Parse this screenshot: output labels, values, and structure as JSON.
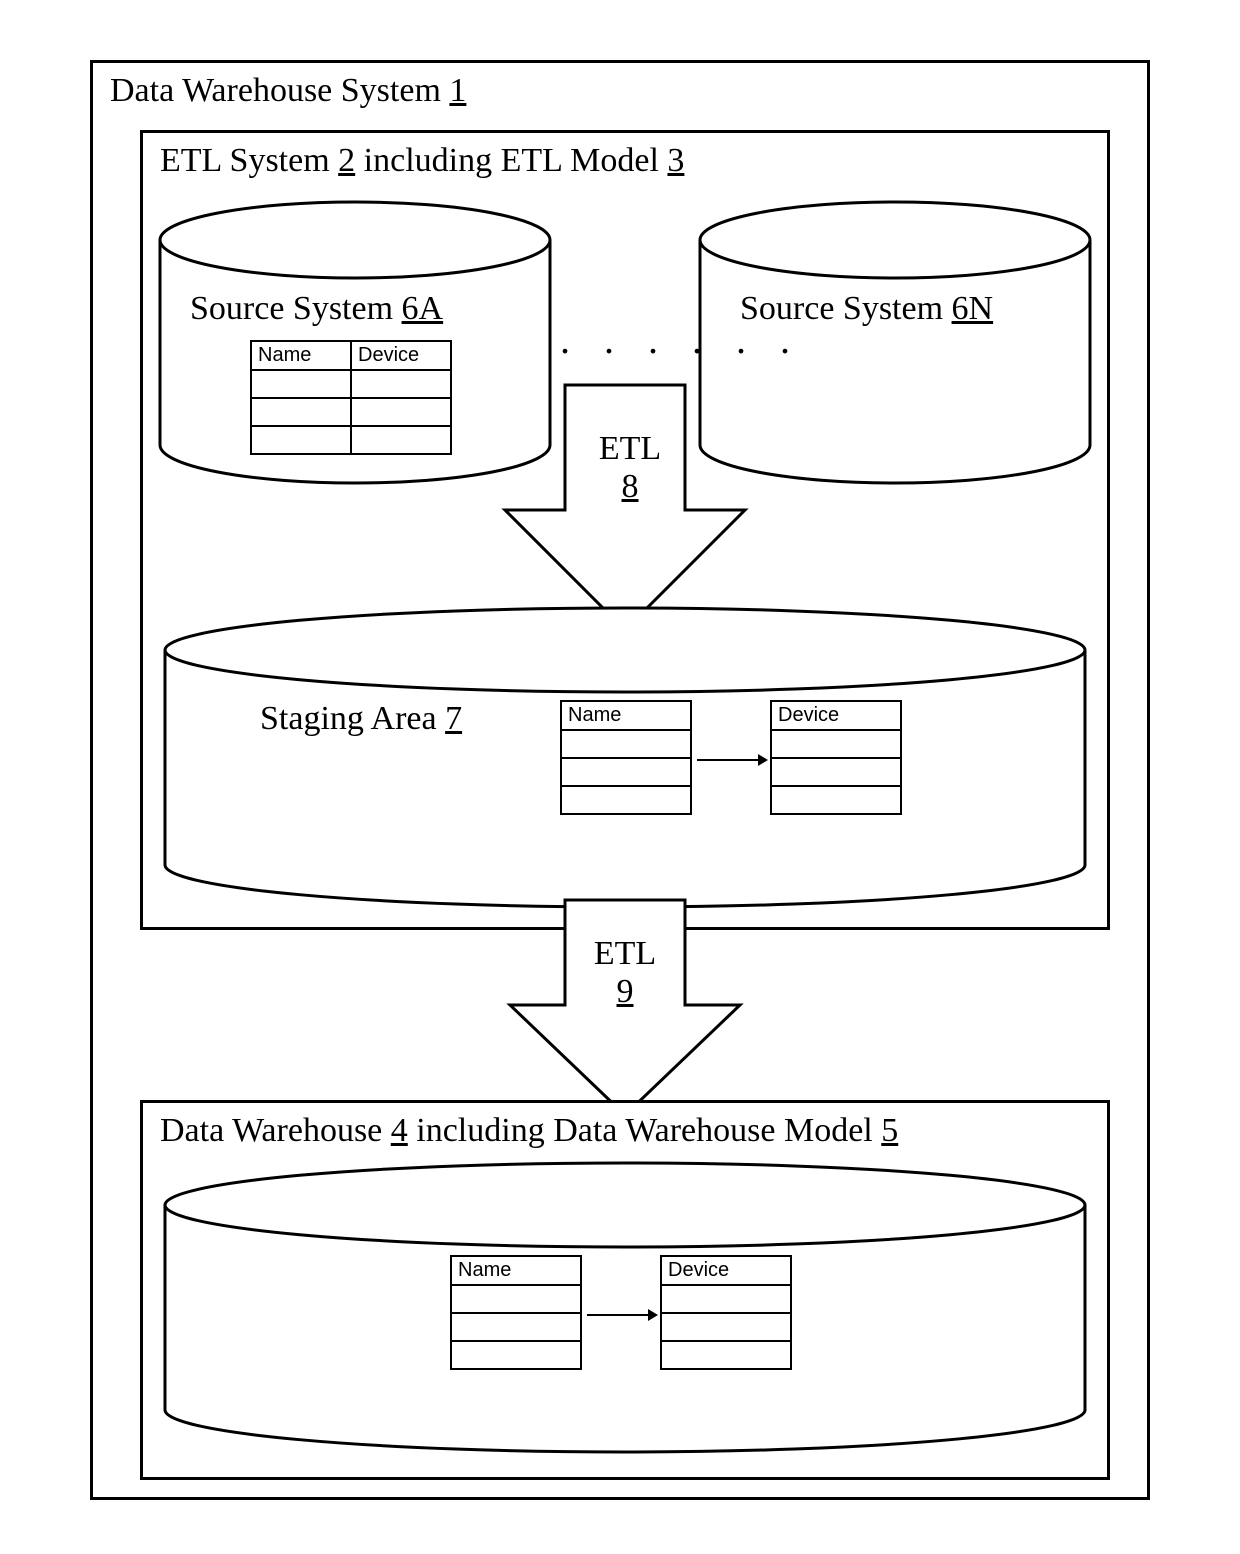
{
  "outer": {
    "title_prefix": "Data Warehouse System ",
    "title_num": "1"
  },
  "etl_system": {
    "title_prefix": "ETL System ",
    "title_num": "2",
    "title_mid": " including ETL Model ",
    "title_num2": "3"
  },
  "source_a": {
    "label_prefix": "Source System ",
    "label_num": "6A",
    "table_headers": [
      "Name",
      "Device"
    ]
  },
  "source_n": {
    "label_prefix": "Source System ",
    "label_num": "6N"
  },
  "dots": ". . . . . .",
  "etl8": {
    "label": "ETL",
    "num": "8"
  },
  "staging": {
    "label_prefix": "Staging Area ",
    "label_num": "7",
    "table_left_header": "Name",
    "table_right_header": "Device"
  },
  "etl9": {
    "label": "ETL",
    "num": "9"
  },
  "warehouse": {
    "title_prefix": "Data Warehouse ",
    "title_num": "4",
    "title_mid": " including Data Warehouse Model ",
    "title_num2": "5",
    "table_left_header": "Name",
    "table_right_header": "Device"
  }
}
